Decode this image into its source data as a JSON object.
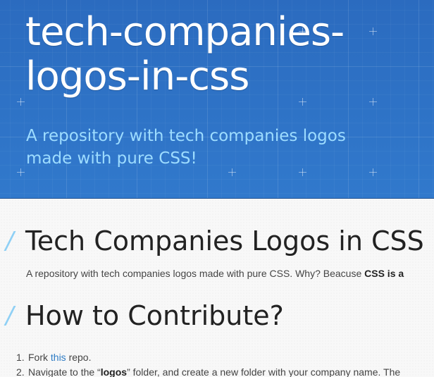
{
  "header": {
    "title": "tech-companies-logos-in-css",
    "tagline": "A repository with tech companies logos made with pure CSS!",
    "colors": {
      "background": "#2f72c6",
      "title": "#ffffff",
      "tagline": "#9ddcff"
    }
  },
  "main": {
    "section_1": {
      "heading": "Tech Companies Logos in CSS",
      "paragraph": {
        "text": "A repository with tech companies logos made with pure CSS. Why? Beacuse ",
        "bold": "CSS is a"
      }
    },
    "section_2": {
      "heading": "How to Contribute?",
      "steps": [
        {
          "number": "1.",
          "before": "Fork ",
          "link": "this",
          "after": " repo."
        },
        {
          "number": "2.",
          "before": "Navigate to the “",
          "bold": "logos",
          "after": "” folder, and create a new folder with your company name. The"
        }
      ]
    },
    "heading_marker": "/",
    "colors": {
      "heading_marker": "#8fd0f5",
      "link": "#2d7bc4"
    }
  }
}
